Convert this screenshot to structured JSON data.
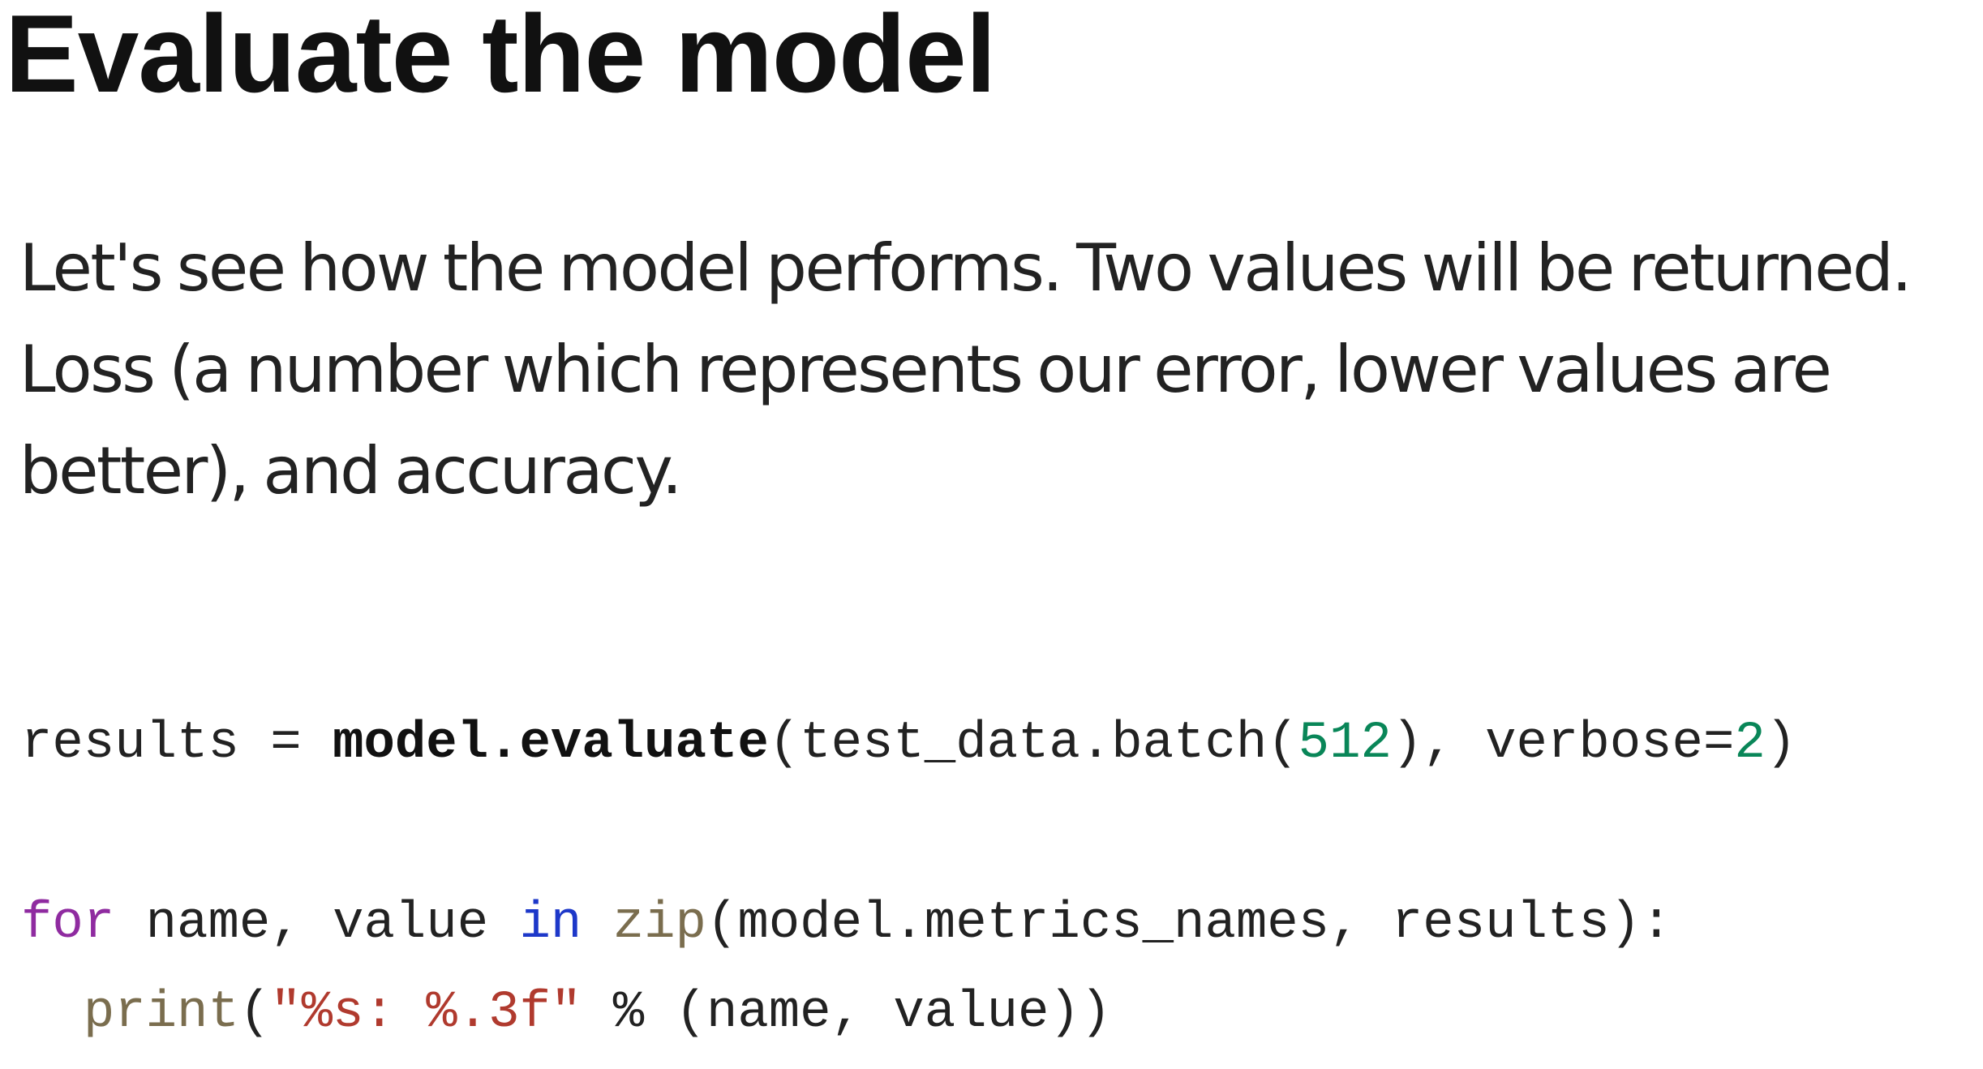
{
  "title": "Evaluate the model",
  "paragraph": "Let's see how the model performs. Two values will be returned. Loss (a number which represents our error, lower values are better), and accuracy.",
  "code": {
    "line1": {
      "var": "results",
      "eq": " = ",
      "call": "model.evaluate",
      "open": "(test_data.batch(",
      "batch_size": "512",
      "mid": "), verbose=",
      "verbose": "2",
      "close": ")"
    },
    "line2": {
      "kw_for": "for",
      "vars": " name, value ",
      "kw_in": "in",
      "sp": " ",
      "fn_zip": "zip",
      "args": "(model.metrics_names, results):"
    },
    "line3": {
      "indent": "  ",
      "fn_print": "print",
      "open": "(",
      "fmt_string": "\"%s: %.3f\"",
      "rest": " % (name, value))"
    }
  },
  "colors": {
    "number": "#098658",
    "keyword_for": "#8f2ba0",
    "keyword_in": "#1d38c9",
    "builtin": "#7a6d4e",
    "string": "#b03a2e"
  }
}
